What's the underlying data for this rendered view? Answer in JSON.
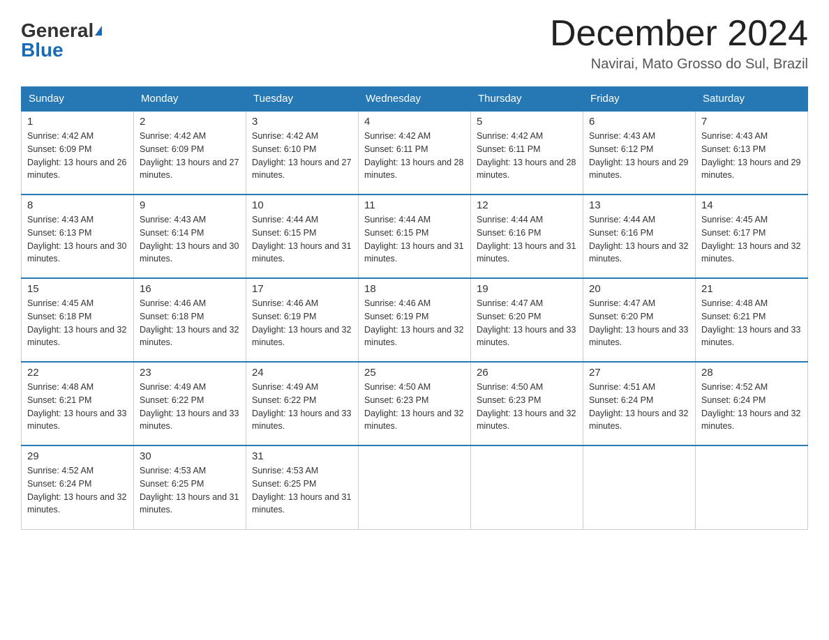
{
  "logo": {
    "part1": "General",
    "part2": "Blue"
  },
  "header": {
    "month": "December 2024",
    "location": "Navirai, Mato Grosso do Sul, Brazil"
  },
  "days_of_week": [
    "Sunday",
    "Monday",
    "Tuesday",
    "Wednesday",
    "Thursday",
    "Friday",
    "Saturday"
  ],
  "weeks": [
    [
      {
        "day": "1",
        "sunrise": "4:42 AM",
        "sunset": "6:09 PM",
        "daylight": "13 hours and 26 minutes."
      },
      {
        "day": "2",
        "sunrise": "4:42 AM",
        "sunset": "6:09 PM",
        "daylight": "13 hours and 27 minutes."
      },
      {
        "day": "3",
        "sunrise": "4:42 AM",
        "sunset": "6:10 PM",
        "daylight": "13 hours and 27 minutes."
      },
      {
        "day": "4",
        "sunrise": "4:42 AM",
        "sunset": "6:11 PM",
        "daylight": "13 hours and 28 minutes."
      },
      {
        "day": "5",
        "sunrise": "4:42 AM",
        "sunset": "6:11 PM",
        "daylight": "13 hours and 28 minutes."
      },
      {
        "day": "6",
        "sunrise": "4:43 AM",
        "sunset": "6:12 PM",
        "daylight": "13 hours and 29 minutes."
      },
      {
        "day": "7",
        "sunrise": "4:43 AM",
        "sunset": "6:13 PM",
        "daylight": "13 hours and 29 minutes."
      }
    ],
    [
      {
        "day": "8",
        "sunrise": "4:43 AM",
        "sunset": "6:13 PM",
        "daylight": "13 hours and 30 minutes."
      },
      {
        "day": "9",
        "sunrise": "4:43 AM",
        "sunset": "6:14 PM",
        "daylight": "13 hours and 30 minutes."
      },
      {
        "day": "10",
        "sunrise": "4:44 AM",
        "sunset": "6:15 PM",
        "daylight": "13 hours and 31 minutes."
      },
      {
        "day": "11",
        "sunrise": "4:44 AM",
        "sunset": "6:15 PM",
        "daylight": "13 hours and 31 minutes."
      },
      {
        "day": "12",
        "sunrise": "4:44 AM",
        "sunset": "6:16 PM",
        "daylight": "13 hours and 31 minutes."
      },
      {
        "day": "13",
        "sunrise": "4:44 AM",
        "sunset": "6:16 PM",
        "daylight": "13 hours and 32 minutes."
      },
      {
        "day": "14",
        "sunrise": "4:45 AM",
        "sunset": "6:17 PM",
        "daylight": "13 hours and 32 minutes."
      }
    ],
    [
      {
        "day": "15",
        "sunrise": "4:45 AM",
        "sunset": "6:18 PM",
        "daylight": "13 hours and 32 minutes."
      },
      {
        "day": "16",
        "sunrise": "4:46 AM",
        "sunset": "6:18 PM",
        "daylight": "13 hours and 32 minutes."
      },
      {
        "day": "17",
        "sunrise": "4:46 AM",
        "sunset": "6:19 PM",
        "daylight": "13 hours and 32 minutes."
      },
      {
        "day": "18",
        "sunrise": "4:46 AM",
        "sunset": "6:19 PM",
        "daylight": "13 hours and 32 minutes."
      },
      {
        "day": "19",
        "sunrise": "4:47 AM",
        "sunset": "6:20 PM",
        "daylight": "13 hours and 33 minutes."
      },
      {
        "day": "20",
        "sunrise": "4:47 AM",
        "sunset": "6:20 PM",
        "daylight": "13 hours and 33 minutes."
      },
      {
        "day": "21",
        "sunrise": "4:48 AM",
        "sunset": "6:21 PM",
        "daylight": "13 hours and 33 minutes."
      }
    ],
    [
      {
        "day": "22",
        "sunrise": "4:48 AM",
        "sunset": "6:21 PM",
        "daylight": "13 hours and 33 minutes."
      },
      {
        "day": "23",
        "sunrise": "4:49 AM",
        "sunset": "6:22 PM",
        "daylight": "13 hours and 33 minutes."
      },
      {
        "day": "24",
        "sunrise": "4:49 AM",
        "sunset": "6:22 PM",
        "daylight": "13 hours and 33 minutes."
      },
      {
        "day": "25",
        "sunrise": "4:50 AM",
        "sunset": "6:23 PM",
        "daylight": "13 hours and 32 minutes."
      },
      {
        "day": "26",
        "sunrise": "4:50 AM",
        "sunset": "6:23 PM",
        "daylight": "13 hours and 32 minutes."
      },
      {
        "day": "27",
        "sunrise": "4:51 AM",
        "sunset": "6:24 PM",
        "daylight": "13 hours and 32 minutes."
      },
      {
        "day": "28",
        "sunrise": "4:52 AM",
        "sunset": "6:24 PM",
        "daylight": "13 hours and 32 minutes."
      }
    ],
    [
      {
        "day": "29",
        "sunrise": "4:52 AM",
        "sunset": "6:24 PM",
        "daylight": "13 hours and 32 minutes."
      },
      {
        "day": "30",
        "sunrise": "4:53 AM",
        "sunset": "6:25 PM",
        "daylight": "13 hours and 31 minutes."
      },
      {
        "day": "31",
        "sunrise": "4:53 AM",
        "sunset": "6:25 PM",
        "daylight": "13 hours and 31 minutes."
      },
      null,
      null,
      null,
      null
    ]
  ]
}
